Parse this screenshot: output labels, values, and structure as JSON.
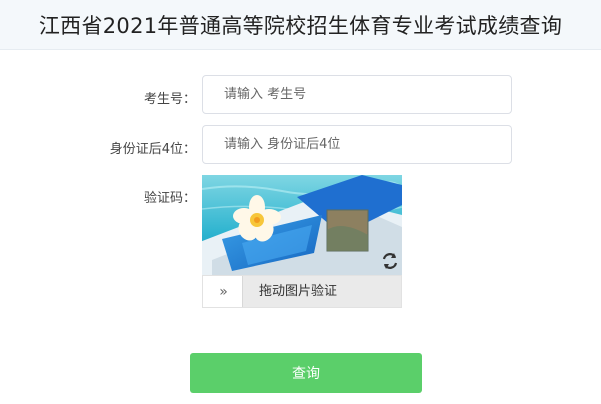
{
  "page": {
    "title": "江西省2021年普通高等院校招生体育专业考试成绩查询"
  },
  "form": {
    "exam_number": {
      "label": "考生号：",
      "value": "",
      "placeholder": "请输入 考生号"
    },
    "id_last4": {
      "label": "身份证后4位：",
      "value": "",
      "placeholder": "请输入 身份证后4位"
    },
    "captcha": {
      "label": "验证码：",
      "slider_handle": "»",
      "slider_hint": "拖动图片验证",
      "icons": {
        "refresh": "refresh-icon",
        "handle": "double-chevron-right-icon"
      }
    },
    "submit_label": "查询"
  },
  "colors": {
    "header_bg": "#f4f8fb",
    "button_bg": "#5bcf6a",
    "button_text": "#ffffff",
    "input_border": "#dcdfe6"
  }
}
